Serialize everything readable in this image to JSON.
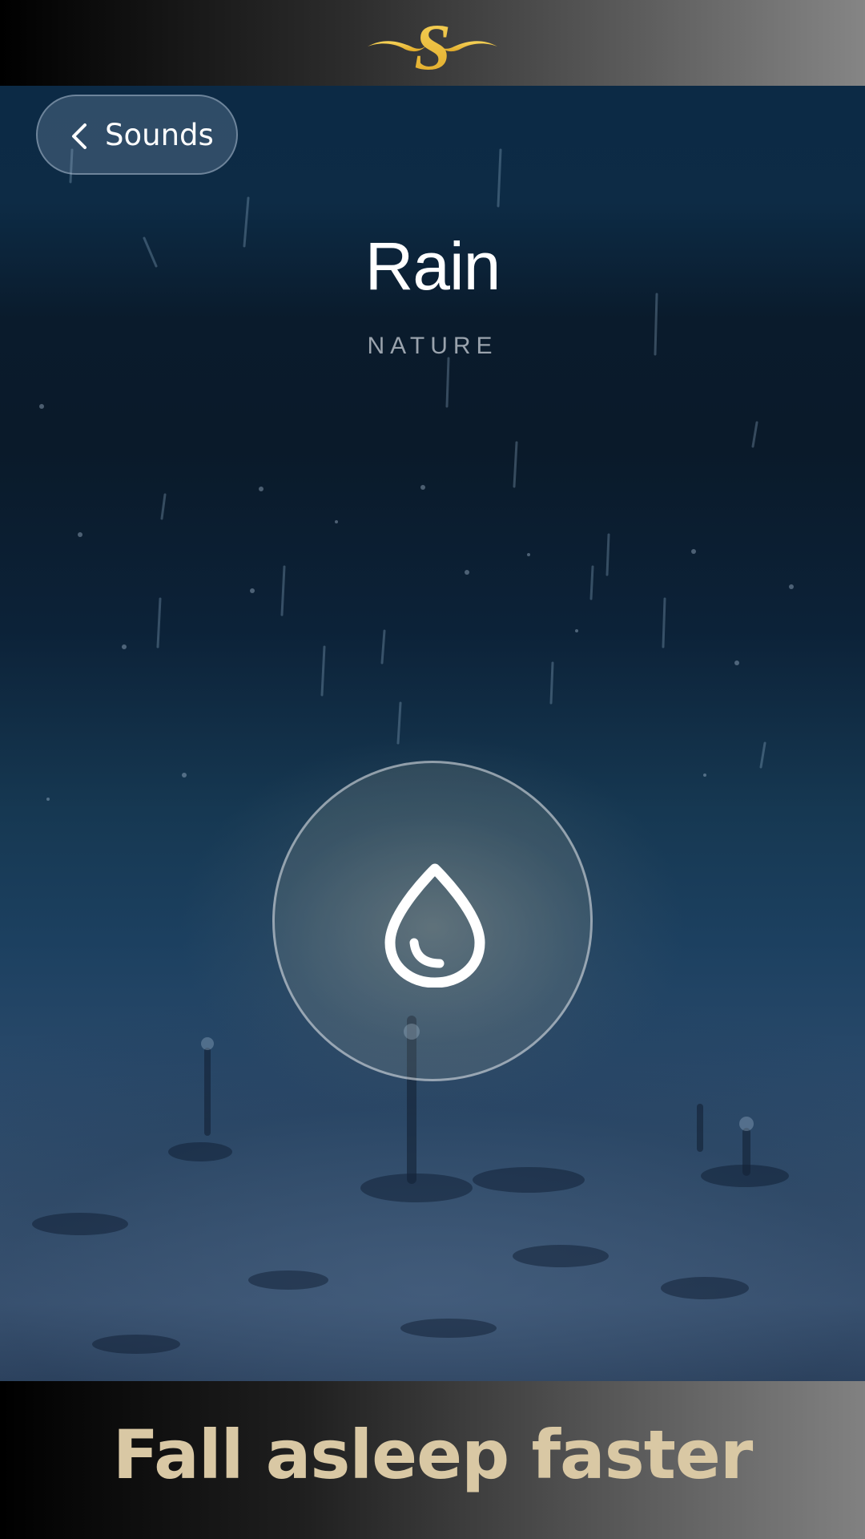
{
  "brand": {
    "logo_letter": "S",
    "logo_color": "#f3c63e"
  },
  "header": {
    "back_label": "Sounds"
  },
  "sound": {
    "title": "Rain",
    "category": "NATURE",
    "icon": "water-drop-icon"
  },
  "footer": {
    "tagline": "Fall asleep faster",
    "tagline_color": "#d9c8a4"
  },
  "colors": {
    "background": "#0c2238",
    "text": "#ffffff",
    "subtitle": "#9aa3ad"
  }
}
